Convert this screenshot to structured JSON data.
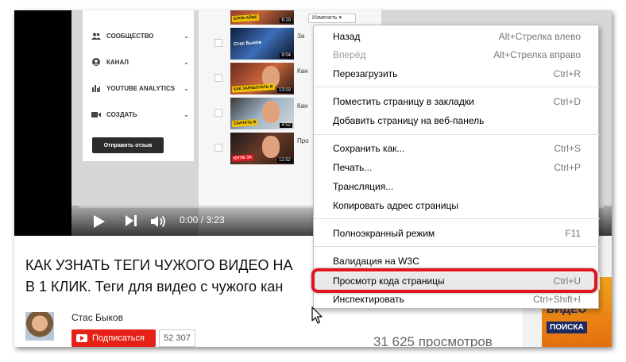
{
  "yt_sidebar": {
    "items": [
      {
        "label": "СООБЩЕСТВО",
        "icon": "people-icon"
      },
      {
        "label": "КАНАЛ",
        "icon": "person-icon"
      },
      {
        "label": "YOUTUBE ANALYTICS",
        "icon": "bar-chart-icon"
      },
      {
        "label": "СОЗДАТЬ",
        "icon": "video-camera-icon"
      }
    ],
    "feedback_button": "Отправить отзыв"
  },
  "video_list": {
    "change_button": "Изменить",
    "rows": [
      {
        "duration": "6:19",
        "title": "",
        "ribbon": "БЛОК-АЙБЕ"
      },
      {
        "duration": "8:04",
        "title": "За",
        "ribbon": "Стас Быков"
      },
      {
        "duration": "13:03",
        "title": "Кан",
        "ribbon": "КАК ЗАРАБОТАТЬ В"
      },
      {
        "duration": "4:52",
        "title": "Кан",
        "ribbon": "СКАЧАТЬ В"
      },
      {
        "duration": "12:52",
        "title": "Про",
        "ribbon": "ЮТУБ ЗА"
      }
    ]
  },
  "player": {
    "time": "0:00 / 3:23",
    "progress": 0
  },
  "video": {
    "title_line1": "КАК УЗНАТЬ ТЕГИ ЧУЖОГО ВИДЕО НА",
    "title_line2": "В 1 КЛИК. Теги для видео с чужого кан",
    "channel": "Стас Быков",
    "subscribe_label": "Подписаться",
    "subscriber_count": "52 307",
    "views": "31 625 просмотров"
  },
  "promo": {
    "line1": "ВИДЕО",
    "line2": "ПОИСКА"
  },
  "context_menu": {
    "items": [
      {
        "label": "Назад",
        "shortcut": "Alt+Стрелка влево",
        "enabled": true
      },
      {
        "label": "Вперёд",
        "shortcut": "Alt+Стрелка вправо",
        "enabled": false
      },
      {
        "label": "Перезагрузить",
        "shortcut": "Ctrl+R",
        "enabled": true
      },
      {
        "label": "Поместить страницу в закладки",
        "shortcut": "Ctrl+D",
        "enabled": true
      },
      {
        "label": "Добавить страницу на веб-панель",
        "shortcut": "",
        "enabled": true
      },
      {
        "label": "Сохранить как...",
        "shortcut": "Ctrl+S",
        "enabled": true
      },
      {
        "label": "Печать...",
        "shortcut": "Ctrl+P",
        "enabled": true
      },
      {
        "label": "Трансляция...",
        "shortcut": "",
        "enabled": true
      },
      {
        "label": "Копировать адрес страницы",
        "shortcut": "",
        "enabled": true
      },
      {
        "label": "Полноэкранный режим",
        "shortcut": "F11",
        "enabled": true
      },
      {
        "label": "Валидация на W3C",
        "shortcut": "",
        "enabled": true
      },
      {
        "label": "Просмотр кода страницы",
        "shortcut": "Ctrl+U",
        "enabled": true
      },
      {
        "label": "Инспектировать",
        "shortcut": "Ctrl+Shift+I",
        "enabled": true
      }
    ]
  },
  "colors": {
    "highlight_ring": "#e0161f",
    "subscribe": "#e62117"
  }
}
